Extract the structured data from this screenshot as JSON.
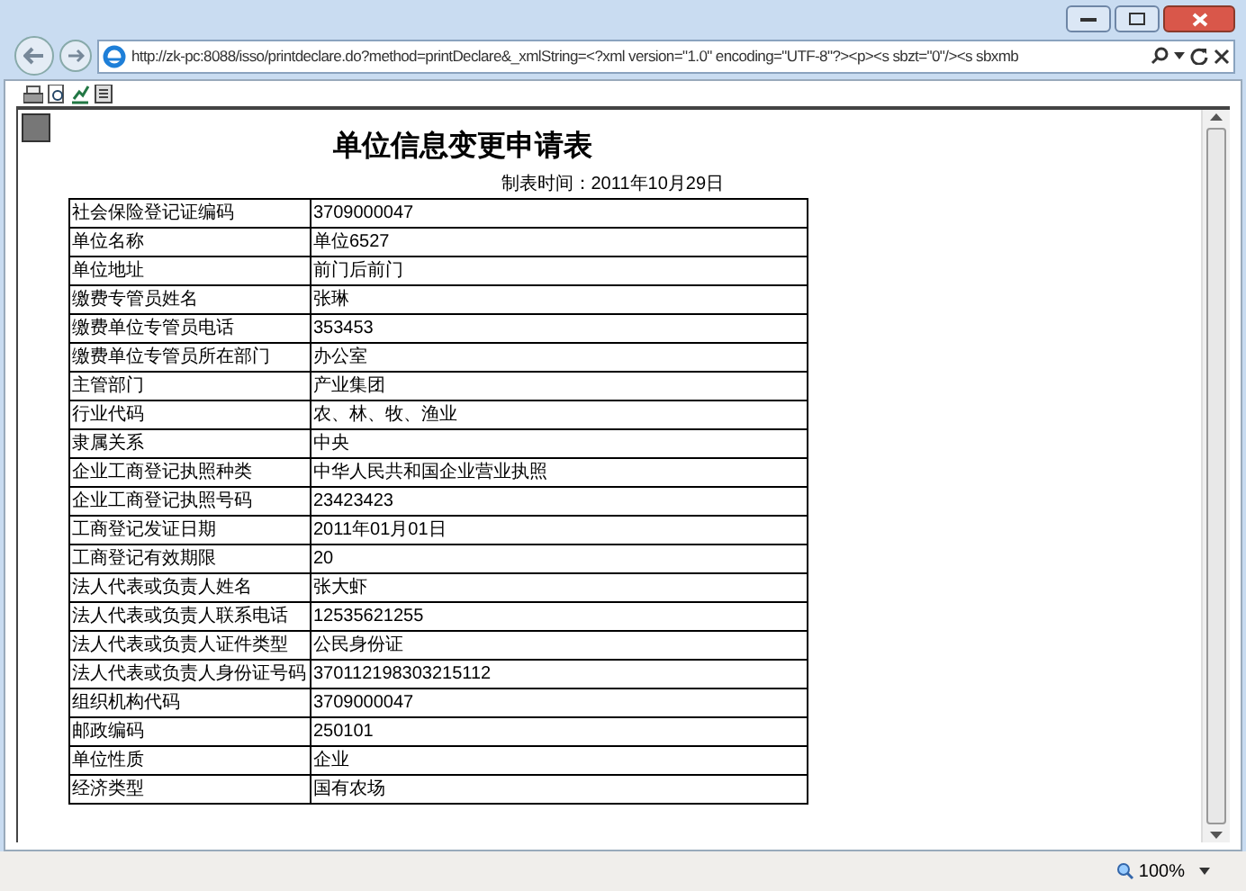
{
  "address_bar": {
    "url": "http://zk-pc:8088/isso/printdeclare.do?method=printDeclare&_xmlString=<?xml version=\"1.0\" encoding=\"UTF-8\"?><p><s sbzt=\"0\"/><s sbxmb"
  },
  "document": {
    "title": "单位信息变更申请表",
    "date": "制表时间：2011年10月29日",
    "rows": [
      {
        "label": "社会保险登记证编码",
        "value": "3709000047"
      },
      {
        "label": "单位名称",
        "value": "单位6527"
      },
      {
        "label": "单位地址",
        "value": "前门后前门"
      },
      {
        "label": "缴费专管员姓名",
        "value": "张琳"
      },
      {
        "label": "缴费单位专管员电话",
        "value": "353453"
      },
      {
        "label": "缴费单位专管员所在部门",
        "value": "办公室"
      },
      {
        "label": "主管部门",
        "value": "产业集团"
      },
      {
        "label": "行业代码",
        "value": "农、林、牧、渔业"
      },
      {
        "label": "隶属关系",
        "value": "中央"
      },
      {
        "label": "企业工商登记执照种类",
        "value": "中华人民共和国企业营业执照"
      },
      {
        "label": "企业工商登记执照号码",
        "value": "23423423"
      },
      {
        "label": "工商登记发证日期",
        "value": "2011年01月01日"
      },
      {
        "label": "工商登记有效期限",
        "value": "20"
      },
      {
        "label": "法人代表或负责人姓名",
        "value": "张大虾"
      },
      {
        "label": "法人代表或负责人联系电话",
        "value": "12535621255"
      },
      {
        "label": "法人代表或负责人证件类型",
        "value": "公民身份证"
      },
      {
        "label": "法人代表或负责人身份证号码",
        "value": "370112198303215112"
      },
      {
        "label": "组织机构代码",
        "value": "3709000047"
      },
      {
        "label": "邮政编码",
        "value": "250101"
      },
      {
        "label": "单位性质",
        "value": "企业"
      },
      {
        "label": "经济类型",
        "value": "国有农场"
      }
    ]
  },
  "status_bar": {
    "zoom": "100%"
  }
}
